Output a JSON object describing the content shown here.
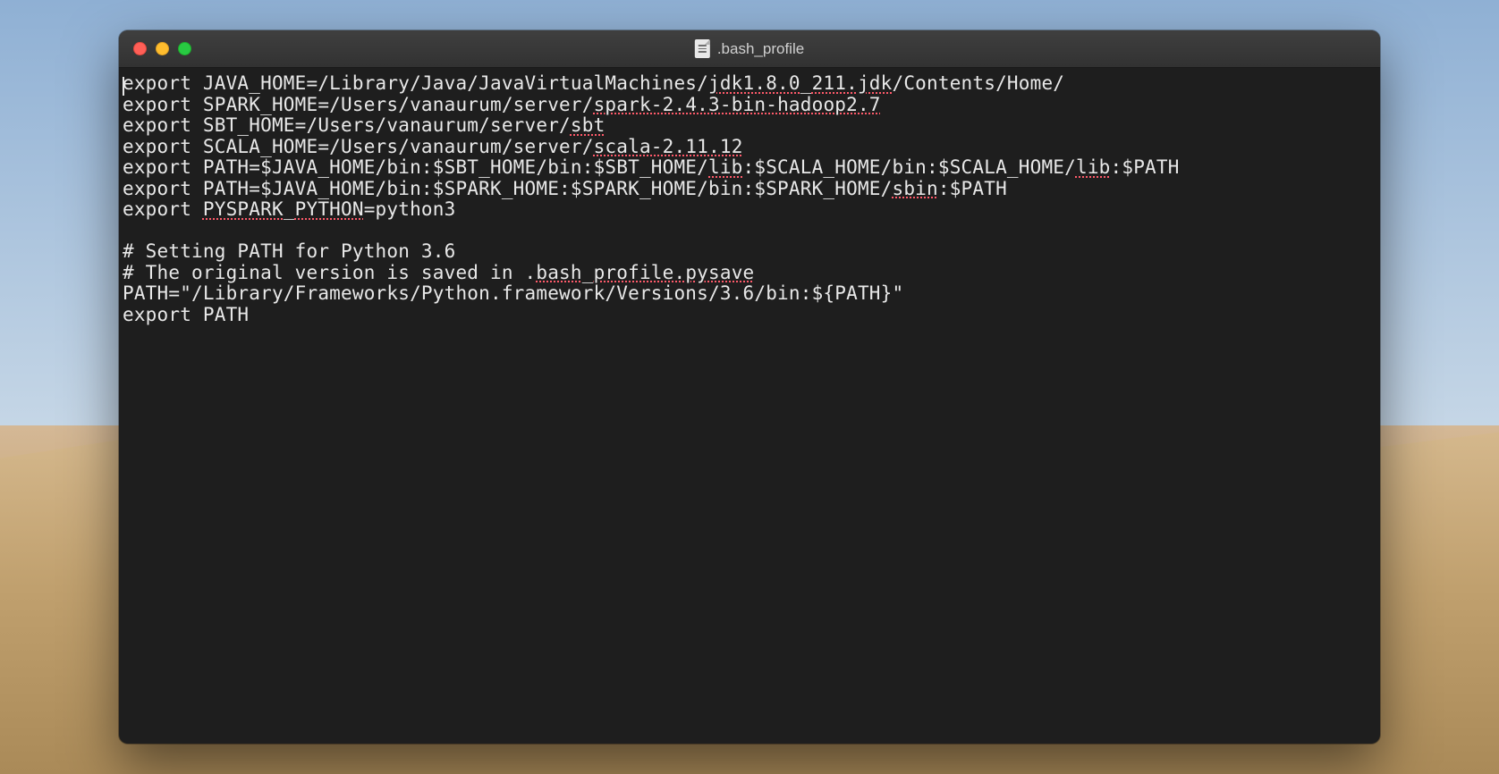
{
  "window": {
    "title": ".bash_profile"
  },
  "editor": {
    "lines": [
      {
        "segments": [
          {
            "t": "export JAVA_HOME=/Library/Java/JavaVirtualMachines/"
          },
          {
            "t": "jdk1.8.0",
            "s": true
          },
          {
            "t": "_"
          },
          {
            "t": "211.jdk",
            "s": true
          },
          {
            "t": "/Contents/Home/"
          }
        ]
      },
      {
        "segments": [
          {
            "t": "export SPARK_HOME=/Users/vanaurum/server/"
          },
          {
            "t": "spark-2.4.3-bin-hadoop2.7",
            "s": true
          }
        ]
      },
      {
        "segments": [
          {
            "t": "export SBT_HOME=/Users/vanaurum/server/"
          },
          {
            "t": "sbt",
            "s": true
          }
        ]
      },
      {
        "segments": [
          {
            "t": "export SCALA_HOME=/Users/vanaurum/server/"
          },
          {
            "t": "scala-2.11.12",
            "s": true
          }
        ]
      },
      {
        "segments": [
          {
            "t": "export PATH=$JAVA_HOME/bin:$SBT_HOME/bin:$SBT_HOME/"
          },
          {
            "t": "lib",
            "s": true
          },
          {
            "t": ":$SCALA_HOME/bin:$SCALA_HOME/"
          },
          {
            "t": "lib",
            "s": true
          },
          {
            "t": ":$PATH"
          }
        ]
      },
      {
        "segments": [
          {
            "t": "export PATH=$JAVA_HOME/bin:$SPARK_HOME:$SPARK_HOME/bin:$SPARK_HOME/"
          },
          {
            "t": "sbin",
            "s": true
          },
          {
            "t": ":$PATH"
          }
        ]
      },
      {
        "segments": [
          {
            "t": "export "
          },
          {
            "t": "PYSPARK",
            "s": true
          },
          {
            "t": "_"
          },
          {
            "t": "PYTHON",
            "s": true
          },
          {
            "t": "=python3"
          }
        ]
      },
      {
        "segments": [
          {
            "t": ""
          }
        ]
      },
      {
        "segments": [
          {
            "t": "# Setting PATH for Python 3.6"
          }
        ]
      },
      {
        "segments": [
          {
            "t": "# The original version is saved in ."
          },
          {
            "t": "bash",
            "s": true
          },
          {
            "t": "_"
          },
          {
            "t": "profile.pysave",
            "s": true
          }
        ]
      },
      {
        "segments": [
          {
            "t": "PATH=\"/Library/Frameworks/Python.framework/Versions/3.6/bin:${PATH}\""
          }
        ]
      },
      {
        "segments": [
          {
            "t": "export PATH"
          }
        ]
      }
    ]
  }
}
